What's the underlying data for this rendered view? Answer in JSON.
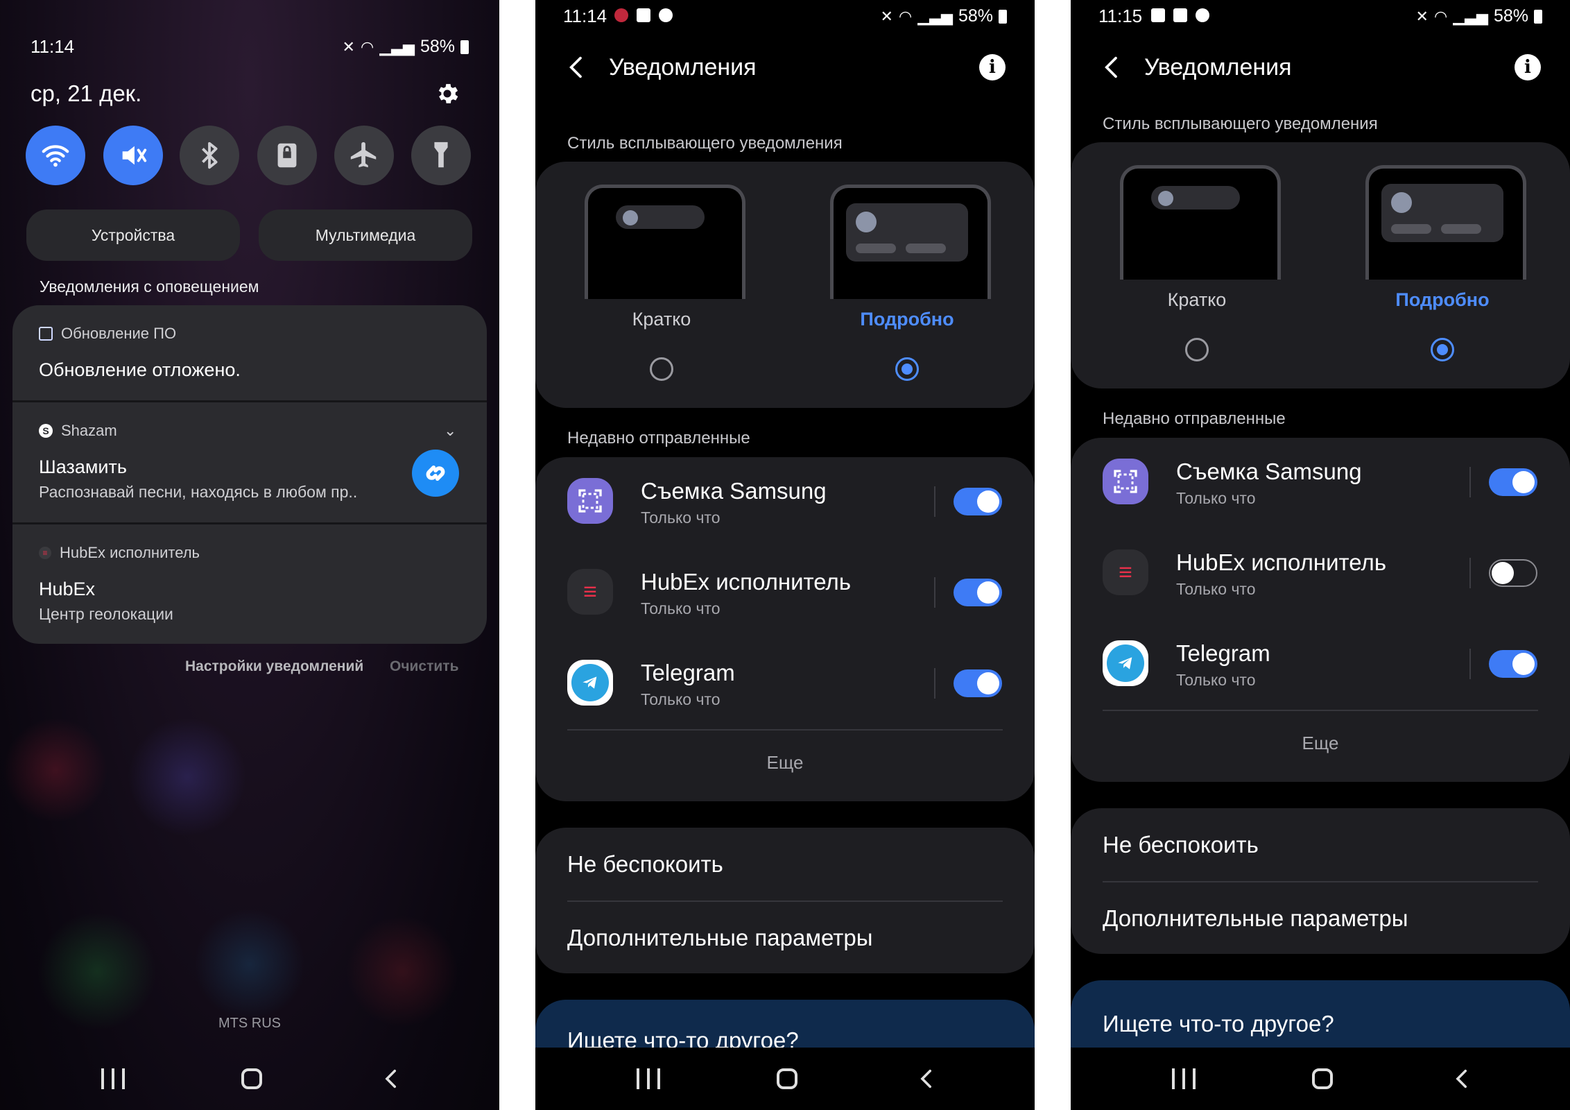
{
  "screen1": {
    "status_time": "11:14",
    "battery": "58%",
    "date": "ср, 21 дек.",
    "quick_tiles": [
      {
        "name": "wifi-icon",
        "on": true
      },
      {
        "name": "mute-icon",
        "on": true
      },
      {
        "name": "bluetooth-icon",
        "on": false
      },
      {
        "name": "lock-rotation-icon",
        "on": false
      },
      {
        "name": "airplane-icon",
        "on": false
      },
      {
        "name": "flashlight-icon",
        "on": false
      }
    ],
    "devices_label": "Устройства",
    "media_label": "Мультимедиа",
    "alerts_header": "Уведомления с оповещением",
    "notifications": [
      {
        "app": "Обновление ПО",
        "title": "Обновление отложено.",
        "text": ""
      },
      {
        "app": "Shazam",
        "title": "Шазамить",
        "text": "Распознавай песни, находясь в любом пр.."
      },
      {
        "app": "HubEx исполнитель",
        "title": "HubEx",
        "text": "Центр геолокации"
      }
    ],
    "notif_settings": "Настройки уведомлений",
    "clear": "Очистить",
    "carrier": "MTS RUS"
  },
  "screen2": {
    "status_time": "11:14",
    "battery": "58%",
    "title": "Уведомления",
    "popup_style_label": "Стиль всплывающего уведомления",
    "brief_label": "Кратко",
    "detailed_label": "Подробно",
    "selected_style": "detailed",
    "recent_label": "Недавно отправленные",
    "apps": [
      {
        "name": "Съемка Samsung",
        "time": "Только что",
        "enabled": true
      },
      {
        "name": "HubEx исполнитель",
        "time": "Только что",
        "enabled": true
      },
      {
        "name": "Telegram",
        "time": "Только что",
        "enabled": true
      }
    ],
    "more": "Еще",
    "dnd": "Не беспокоить",
    "advanced": "Дополнительные параметры",
    "search_other": "Ищете что-то другое?"
  },
  "screen3": {
    "status_time": "11:15",
    "battery": "58%",
    "title": "Уведомления",
    "popup_style_label": "Стиль всплывающего уведомления",
    "brief_label": "Кратко",
    "detailed_label": "Подробно",
    "selected_style": "detailed",
    "recent_label": "Недавно отправленные",
    "apps": [
      {
        "name": "Съемка Samsung",
        "time": "Только что",
        "enabled": true
      },
      {
        "name": "HubEx исполнитель",
        "time": "Только что",
        "enabled": false
      },
      {
        "name": "Telegram",
        "time": "Только что",
        "enabled": true
      }
    ],
    "more": "Еще",
    "dnd": "Не беспокоить",
    "advanced": "Дополнительные параметры",
    "search_other": "Ищете что-то другое?"
  },
  "colors": {
    "accent": "#3e7bf5",
    "selected_text": "#4e8dff",
    "card": "#1e1e22",
    "search_card": "#0f2a4c"
  }
}
